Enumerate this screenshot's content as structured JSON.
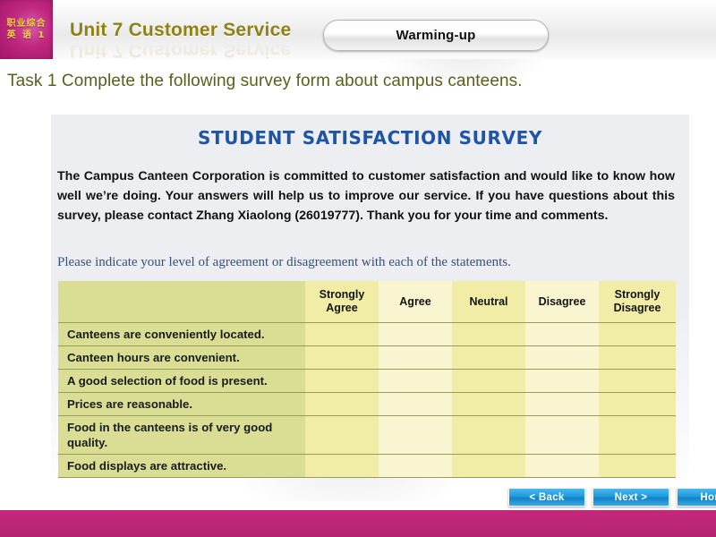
{
  "header": {
    "logo_line1": "职业综合",
    "logo_line2": "英 语 1",
    "unit_title": "Unit 7 Customer Service",
    "section_button": "Warming-up",
    "accent_magenta": "#c4277c",
    "title_color": "#8f8214"
  },
  "task": {
    "line": "Task 1 Complete the following survey form about campus  canteens.",
    "color": "#59601f"
  },
  "survey": {
    "title": "STUDENT SATISFACTION SURVEY",
    "title_color": "#1f55a5",
    "body": "The Campus Canteen Corporation is committed to customer satisfaction and would like to know how well we’re doing. Your answers will help us to improve our service. If you have questions about this survey, please contact Zhang Xiaolong (26019777). Thank you for your time and comments.",
    "note": "Please indicate your level of agreement or disagreement with each of the statements.",
    "note_color": "#3a4f7a",
    "table": {
      "columns": [
        "",
        "Strongly Agree",
        "Agree",
        "Neutral",
        "Disagree",
        "Strongly Disagree"
      ],
      "rows": [
        "Canteens are conveniently located.",
        "Canteen hours are convenient.",
        "A good selection of food is present.",
        "Prices are reasonable.",
        "Food in the canteens is of very good quality.",
        "Food displays are attractive."
      ],
      "header_fill": "#f0eda6",
      "label_fill": "#d9de94",
      "cell_fill_a": "#f1eda6",
      "cell_fill_b": "#f8f5d0",
      "grid_color": "#9a9b5a"
    }
  },
  "nav": {
    "back": "< Back",
    "next": "Next >",
    "home": "Home",
    "color": "#1f9bdd"
  }
}
